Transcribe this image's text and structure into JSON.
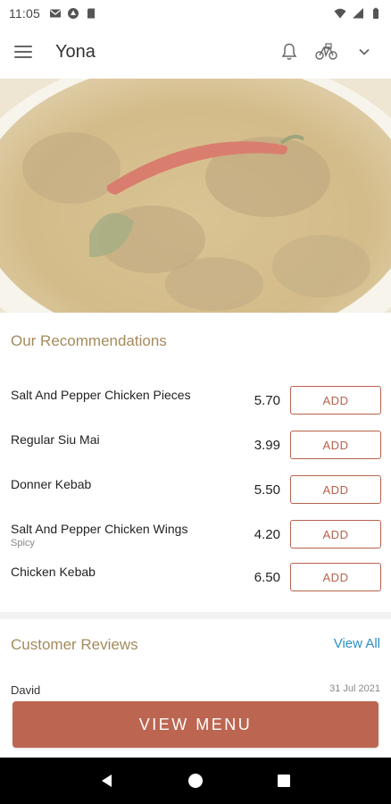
{
  "status_bar": {
    "time": "11:05",
    "left_icons": [
      "gmail-icon",
      "google-drive-icon",
      "sd-card-icon"
    ],
    "right_icons": [
      "wifi-icon",
      "cellular-signal-icon",
      "battery-icon"
    ]
  },
  "app_bar": {
    "menu_icon": "hamburger-menu-icon",
    "title": "Yona",
    "actions": [
      "bell-icon",
      "bicycle-delivery-icon",
      "chevron-down-icon"
    ]
  },
  "hero": {
    "image_subject": "curry-dish-with-red-chili"
  },
  "recommendations": {
    "title": "Our Recommendations",
    "items": [
      {
        "name": "Salt And Pepper Chicken Pieces",
        "subtitle": "",
        "price": "5.70",
        "button": "ADD"
      },
      {
        "name": "Regular Siu Mai",
        "subtitle": "",
        "price": "3.99",
        "button": "ADD"
      },
      {
        "name": "Donner Kebab",
        "subtitle": "",
        "price": "5.50",
        "button": "ADD"
      },
      {
        "name": "Salt And Pepper Chicken Wings",
        "subtitle": "Spicy",
        "price": "4.20",
        "button": "ADD"
      },
      {
        "name": "Chicken Kebab",
        "subtitle": "",
        "price": "6.50",
        "button": "ADD"
      }
    ]
  },
  "reviews": {
    "title": "Customer Reviews",
    "view_all": "View All",
    "first_author": "David",
    "first_date": "31 Jul 2021"
  },
  "cta": {
    "label": "VIEW MENU"
  },
  "nav_bar": {
    "buttons": [
      "back-icon",
      "home-icon",
      "recents-icon"
    ]
  },
  "colors": {
    "accent": "#bc6651",
    "section_title": "#a48a5c",
    "link": "#2b8fc4"
  }
}
